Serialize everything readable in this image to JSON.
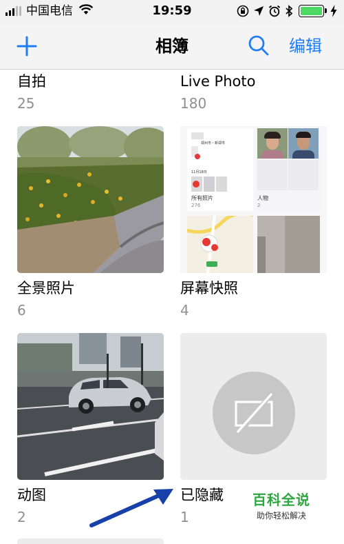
{
  "status_bar": {
    "carrier": "中国电信",
    "time": "19:59"
  },
  "nav": {
    "title": "相簿",
    "edit_label": "编辑"
  },
  "albums": [
    {
      "name": "自拍",
      "count": "25"
    },
    {
      "name": "Live Photo",
      "count": "180"
    },
    {
      "name": "全景照片",
      "count": "6"
    },
    {
      "name": "屏幕快照",
      "count": "4"
    },
    {
      "name": "动图",
      "count": "2"
    },
    {
      "name": "已隐藏",
      "count": "1"
    }
  ],
  "screenshot_thumb": {
    "location": "郑州市・新郑市",
    "date": "11月18日",
    "all_photos_label": "所有照片",
    "all_photos_count": "276",
    "people_label": "人物",
    "people_count": "2"
  },
  "watermark": {
    "title": "百科全说",
    "subtitle": "助你轻松解决"
  },
  "colors": {
    "accent": "#1e7df6",
    "battery": "#4cd964",
    "arrow": "#1740a8"
  }
}
